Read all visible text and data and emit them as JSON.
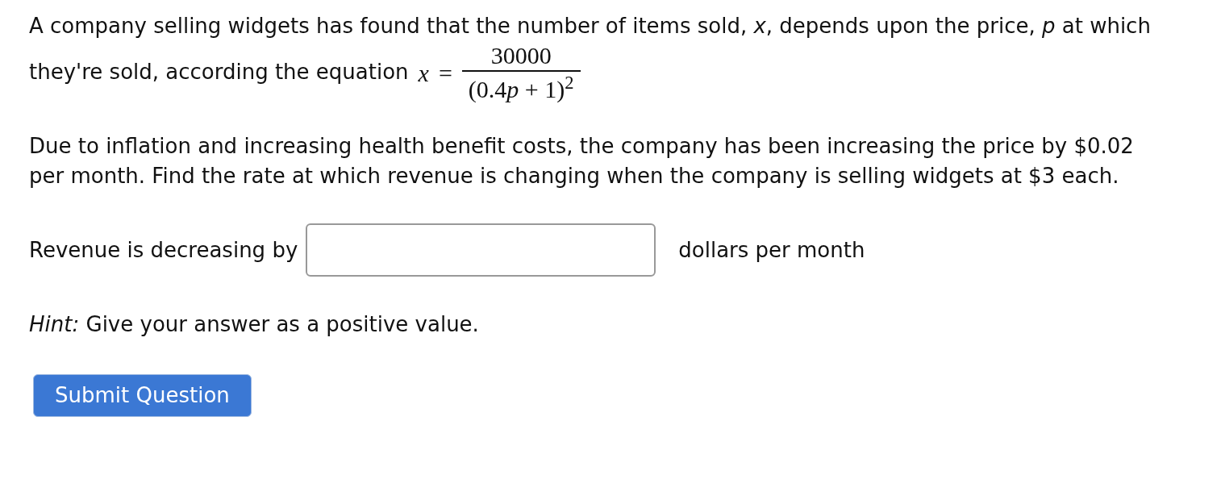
{
  "question": {
    "intro": "A company selling widgets has found that the number of items sold, *x*, depends upon the price, *p* at which they're sold, according the equation",
    "equation": {
      "lhs": "x",
      "relation": "=",
      "numerator": "30000",
      "denominator": [
        {
          "text": "(0.4",
          "italic": false
        },
        {
          "text": "p",
          "italic": true
        },
        {
          "text": " + 1)",
          "italic": false
        }
      ],
      "exponent": "2"
    },
    "body": "Due to inflation and increasing health benefit costs, the company has been increasing the price by $0.02 per month. Find the rate at which revenue is changing when the company is selling widgets at $3 each.",
    "answer": {
      "label": "Revenue is decreasing by",
      "unit": "dollars per month"
    },
    "hint": "*Hint:* Give your answer as a positive value.",
    "submit_button": "Submit Question"
  }
}
